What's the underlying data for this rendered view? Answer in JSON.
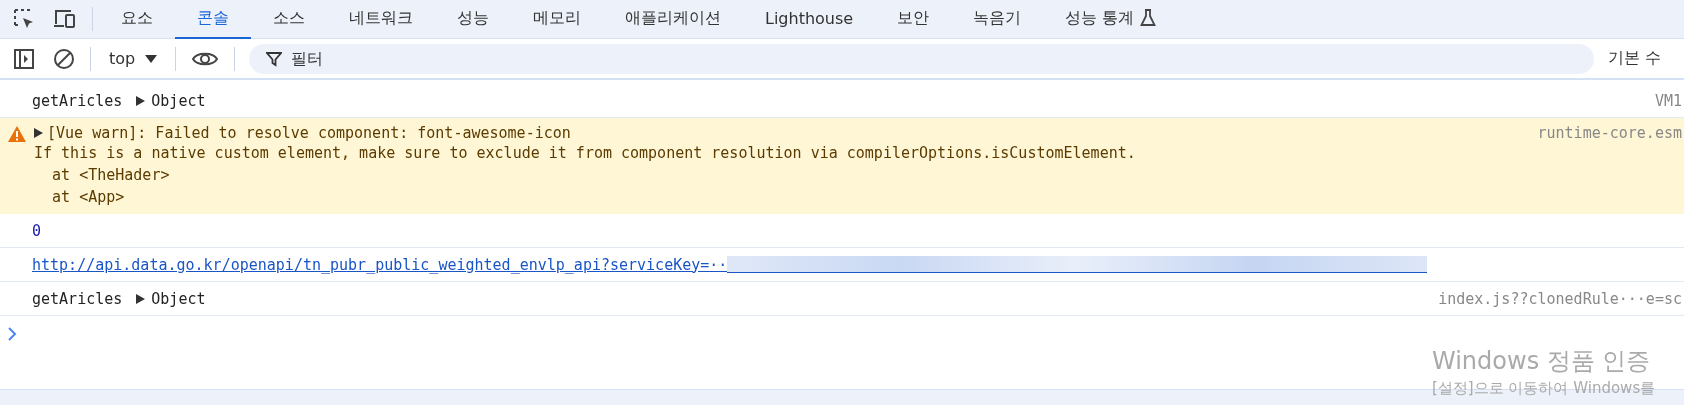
{
  "tabs": [
    {
      "label": "요소",
      "selected": false
    },
    {
      "label": "콘솔",
      "selected": true
    },
    {
      "label": "소스",
      "selected": false
    },
    {
      "label": "네트워크",
      "selected": false
    },
    {
      "label": "성능",
      "selected": false
    },
    {
      "label": "메모리",
      "selected": false
    },
    {
      "label": "애플리케이션",
      "selected": false
    },
    {
      "label": "Lighthouse",
      "selected": false
    },
    {
      "label": "보안",
      "selected": false
    },
    {
      "label": "녹음기",
      "selected": false
    },
    {
      "label": "성능 통계",
      "selected": false,
      "kind": "experiment"
    }
  ],
  "toolbar": {
    "context": "top",
    "filter": {
      "placeholder": "필터"
    },
    "levels": "기본 수"
  },
  "messages": [
    {
      "kind": "log",
      "text": "getAricles",
      "value": "Object",
      "source": "VM1"
    },
    {
      "kind": "warning",
      "summary": "[Vue warn]: Failed to resolve component: font-awesome-icon",
      "lines": [
        "If this is a native custom element, make sure to exclude it from component resolution via compilerOptions.isCustomElement.",
        "  at <TheHader>",
        "  at <App>"
      ],
      "source": "runtime-core.esm"
    },
    {
      "kind": "number",
      "text": "0"
    },
    {
      "kind": "link",
      "text": "http://api.data.go.kr/openapi/tn_pubr_public_weighted_envlp_api?serviceKey=··"
    },
    {
      "kind": "log",
      "text": "getAricles",
      "value": "Object",
      "source": "index.js??clonedRule···e=sc"
    }
  ],
  "os_notice": {
    "title": "Windows 정품 인증",
    "subtitle": "[설정]으로 이동하여 Windows를"
  }
}
